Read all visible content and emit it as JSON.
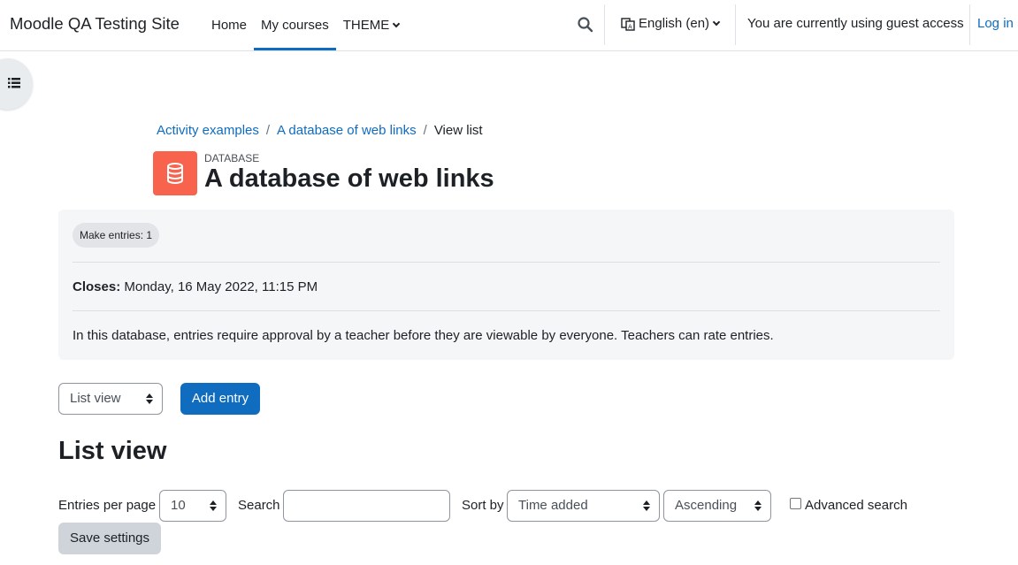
{
  "navbar": {
    "brand": "Moodle QA Testing Site",
    "items": [
      {
        "label": "Home"
      },
      {
        "label": "My courses"
      },
      {
        "label": "THEME"
      }
    ],
    "language": "English (en)",
    "guest_notice": "You are currently using guest access",
    "login": "Log in"
  },
  "breadcrumb": [
    "Activity examples",
    "A database of web links",
    "View list"
  ],
  "header": {
    "module_type": "DATABASE",
    "title": "A database of web links",
    "icon_color": "#f7634d"
  },
  "activity_info": {
    "badge": "Make entries: 1",
    "closes_label": "Closes:",
    "closes_value": "Monday, 16 May 2022, 11:15 PM",
    "intro": "In this database, entries require approval by a teacher before they are viewable by everyone. Teachers can rate entries."
  },
  "actions": {
    "view_select": "List view",
    "add_entry": "Add entry"
  },
  "section_title": "List view",
  "filters": {
    "per_page_label": "Entries per page",
    "per_page_value": "10",
    "search_label": "Search",
    "search_value": "",
    "sort_by_label": "Sort by",
    "sort_by_value": "Time added",
    "order_value": "Ascending",
    "advanced_search_label": "Advanced search",
    "save_settings": "Save settings"
  },
  "colors": {
    "accent": "#0f6cbf",
    "panel": "#f5f6f8"
  }
}
